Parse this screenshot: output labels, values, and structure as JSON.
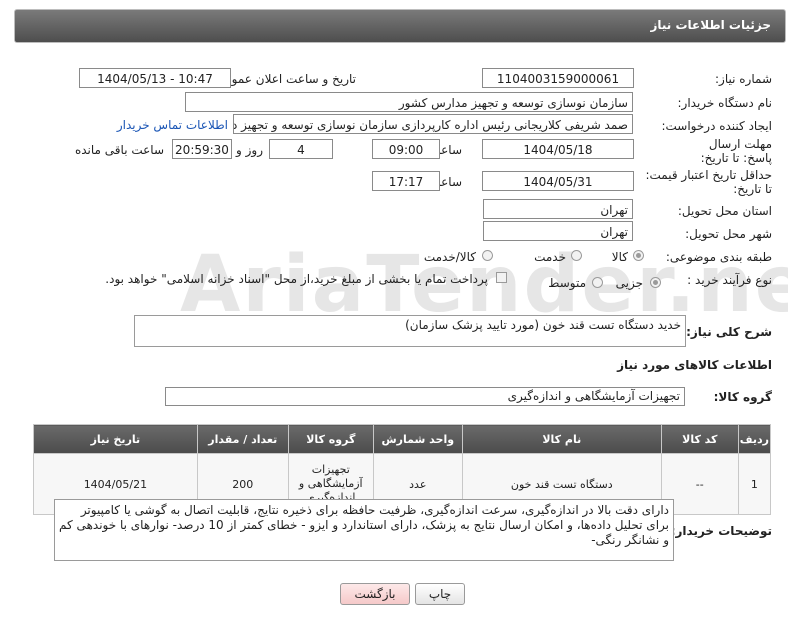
{
  "header": {
    "title": "جزئیات اطلاعات نیاز"
  },
  "fields": {
    "need_number_label": "شماره نیاز:",
    "need_number": "1104003159000061",
    "announce_label": "تاریخ و ساعت اعلان عمومی:",
    "announce_value": "1404/05/13 - 10:47",
    "buyer_org_label": "نام دستگاه خریدار:",
    "buyer_org": "سازمان نوسازی  توسعه و تجهیز مدارس کشور",
    "requester_label": "ایجاد کننده درخواست:",
    "requester": "صمد شریفی کلاریجانی رئیس اداره کارپردازی سازمان نوسازی  توسعه و تجهیز د",
    "contact_link": "اطلاعات تماس خریدار",
    "deadline_label": "مهلت ارسال پاسخ: تا تاریخ:",
    "deadline_date": "1404/05/18",
    "hour_label": "ساعت",
    "deadline_time": "09:00",
    "days_value": "4",
    "days_label": "روز و",
    "remaining_time": "20:59:30",
    "remaining_label": "ساعت باقی مانده",
    "validity_label": "حداقل تاریخ اعتبار قیمت: تا تاریخ:",
    "validity_date": "1404/05/31",
    "validity_hour_label": "ساعت",
    "validity_time": "17:17",
    "province_label": "استان محل تحویل:",
    "province": "تهران",
    "city_label": "شهر محل تحویل:",
    "city": "تهران",
    "category_label": "طبقه بندی موضوعی:",
    "category_options": [
      "کالا",
      "خدمت",
      "کالا/خدمت"
    ],
    "process_label": "نوع فرآیند خرید :",
    "process_options": [
      "جزیی",
      "متوسط"
    ],
    "payment_note": "پرداخت تمام یا بخشی از مبلغ خرید،از محل \"اسناد خزانه اسلامی\" خواهد بود."
  },
  "description": {
    "label": "شرح کلی نیاز:",
    "value": "خدید دستگاه تست قند خون (مورد تایید پزشک سازمان)"
  },
  "goods": {
    "section_title": "اطلاعات کالاهای مورد نیاز",
    "group_label": "گروه کالا:",
    "group_value": "تجهیزات آزمایشگاهی و اندازه‌گیری",
    "columns": [
      "ردیف",
      "کد کالا",
      "نام کالا",
      "واحد شمارش",
      "گروه کالا",
      "تعداد / مقدار",
      "تاریخ نیاز"
    ],
    "rows": [
      {
        "row": "1",
        "code": "--",
        "name": "دستگاه تست قند خون",
        "unit": "عدد",
        "group": "تجهیزات آزمایشگاهی و اندازه‌گیری",
        "qty": "200",
        "date": "1404/05/21"
      }
    ]
  },
  "buyer_notes": {
    "label": "توضیحات خریدار:",
    "value": "دارای دقت بالا در اندازه‌گیری، سرعت اندازه‌گیری، ظرفیت حافظه برای ذخیره نتایج، قابلیت اتصال به گوشی یا کامپیوتر برای تحلیل داده‌ها، و امکان ارسال نتایج به پزشک، دارای استاندارد و ایزو - خطای کمتر از 10 درصد- نوارهای با خوندهی کم و نشانگر رنگی-"
  },
  "buttons": {
    "print": "چاپ",
    "back": "بازگشت"
  },
  "watermark": "AriaTender.neT"
}
